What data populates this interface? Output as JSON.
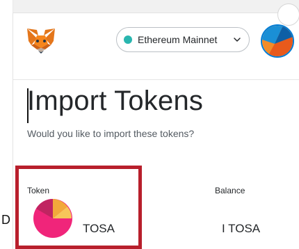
{
  "header": {
    "network": {
      "label": "Ethereum Mainnet",
      "dot_color": "#29b6af",
      "icon": "chevron-down-icon"
    },
    "logo_icon": "metamask-fox-icon",
    "account_avatar_icon": "account-avatar"
  },
  "main": {
    "title": "Import Tokens",
    "subtitle": "Would you like to import these tokens?",
    "columns": {
      "token": "Token",
      "balance": "Balance"
    },
    "tokens": [
      {
        "symbol": "TOSA",
        "balance": "I TOSA",
        "icon": "tosa-token-icon"
      }
    ]
  },
  "background": {
    "left_fragment": "D"
  },
  "colors": {
    "highlight": "#b81f2c",
    "accent": "#037dd6"
  }
}
